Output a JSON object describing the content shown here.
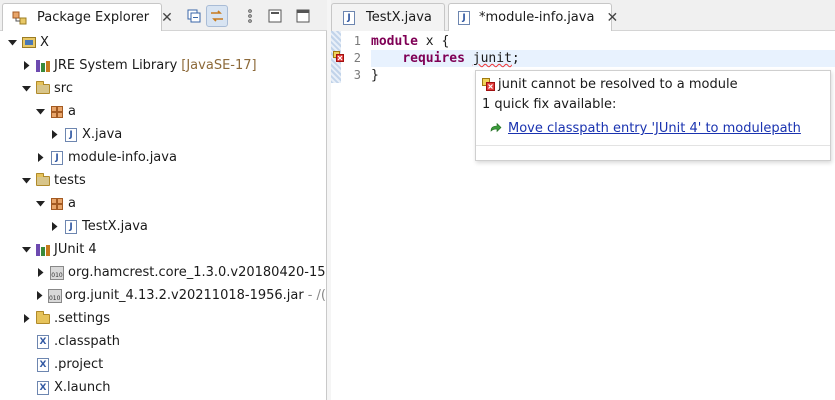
{
  "explorer": {
    "tab_title": "Package Explorer",
    "close_glyph": "✕",
    "toolbar": [
      {
        "icon": "collapse-all-icon"
      },
      {
        "icon": "link-with-editor-icon",
        "active": true
      },
      {
        "icon": "view-menu-icon"
      },
      {
        "icon": "minimize-icon"
      },
      {
        "icon": "maximize-icon"
      }
    ]
  },
  "tree": [
    {
      "label": "X",
      "extra": "",
      "icon": "project-icon",
      "arrow": "down",
      "indent": 0
    },
    {
      "label": "JRE System Library",
      "extra": "[JavaSE-17]",
      "icon": "library-icon",
      "arrow": "right",
      "indent": 1
    },
    {
      "label": "src",
      "extra": "",
      "icon": "source-folder-icon",
      "arrow": "down",
      "indent": 1
    },
    {
      "label": "a",
      "extra": "",
      "icon": "package-icon",
      "arrow": "down",
      "indent": 2
    },
    {
      "label": "X.java",
      "extra": "",
      "icon": "java-file-icon",
      "arrow": "right",
      "indent": 3
    },
    {
      "label": "module-info.java",
      "extra": "",
      "icon": "java-file-icon",
      "arrow": "right",
      "indent": 2
    },
    {
      "label": "tests",
      "extra": "",
      "icon": "source-folder-icon",
      "arrow": "down",
      "indent": 1
    },
    {
      "label": "a",
      "extra": "",
      "icon": "package-icon",
      "arrow": "down",
      "indent": 2
    },
    {
      "label": "TestX.java",
      "extra": "",
      "icon": "java-file-icon",
      "arrow": "right",
      "indent": 3
    },
    {
      "label": "JUnit 4",
      "extra": "",
      "icon": "library-icon",
      "arrow": "down",
      "indent": 1
    },
    {
      "label": "org.hamcrest.core_1.3.0.v20180420-15",
      "extra": "",
      "icon": "jar-icon",
      "arrow": "right",
      "indent": 2
    },
    {
      "label": "org.junit_4.13.2.v20211018-1956.jar",
      "extra": "- /(",
      "icon": "jar-icon",
      "arrow": "right",
      "indent": 2
    },
    {
      "label": ".settings",
      "extra": "",
      "icon": "folder-icon",
      "arrow": "right",
      "indent": 1
    },
    {
      "label": ".classpath",
      "extra": "",
      "icon": "xml-file-icon",
      "arrow": "none",
      "indent": 1
    },
    {
      "label": ".project",
      "extra": "",
      "icon": "xml-file-icon",
      "arrow": "none",
      "indent": 1
    },
    {
      "label": "X.launch",
      "extra": "",
      "icon": "xml-file-icon",
      "arrow": "none",
      "indent": 1
    }
  ],
  "editor": {
    "tabs": [
      {
        "label": "TestX.java",
        "active": false
      },
      {
        "label": "*module-info.java",
        "active": true
      }
    ],
    "lines": [
      {
        "no": "1"
      },
      {
        "no": "2"
      },
      {
        "no": "3"
      }
    ],
    "code": {
      "l1_kw": "module",
      "l1_rest": " x {",
      "l2_indent": "    ",
      "l2_kw": "requires",
      "l2_sp": " ",
      "l2_err": "junit",
      "l2_end": ";",
      "l3": "}"
    }
  },
  "hover": {
    "message": "junit cannot be resolved to a module",
    "count": "1 quick fix available:",
    "fix_label": "Move classpath entry 'JUnit 4' to modulepath"
  },
  "colors": {
    "keyword": "#7f0055",
    "link": "#1a33b0",
    "error": "#e33333",
    "current_line": "#e8f2fe"
  }
}
